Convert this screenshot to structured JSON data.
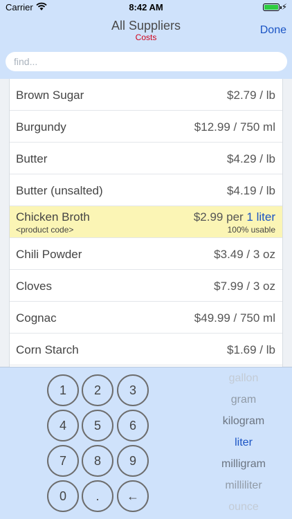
{
  "status_bar": {
    "carrier": "Carrier",
    "time": "8:42 AM"
  },
  "nav": {
    "title": "All Suppliers",
    "subtitle": "Costs",
    "done_label": "Done"
  },
  "search": {
    "placeholder": "find...",
    "value": ""
  },
  "items": [
    {
      "name": "Brown Sugar",
      "price": "$2.79 / lb"
    },
    {
      "name": "Burgundy",
      "price": "$12.99 / 750 ml"
    },
    {
      "name": "Butter",
      "price": "$4.29 / lb"
    },
    {
      "name": "Butter (unsalted)",
      "price": "$4.19 / lb"
    },
    {
      "name": "Chicken Broth",
      "price": "$2.99 per",
      "unit": "1 liter",
      "product_code": "<product code>",
      "usable": "100% usable",
      "selected": true
    },
    {
      "name": "Chili Powder",
      "price": "$3.49 / 3 oz"
    },
    {
      "name": "Cloves",
      "price": "$7.99 / 3 oz"
    },
    {
      "name": "Cognac",
      "price": "$49.99 / 750 ml"
    },
    {
      "name": "Corn Starch",
      "price": "$1.69 / lb"
    }
  ],
  "keypad": {
    "keys": [
      "1",
      "2",
      "3",
      "4",
      "5",
      "6",
      "7",
      "8",
      "9",
      "0",
      ".",
      "←"
    ]
  },
  "unit_picker": {
    "options": [
      "gallon",
      "gram",
      "kilogram",
      "liter",
      "milligram",
      "milliliter",
      "ounce"
    ],
    "selected": "liter"
  },
  "colors": {
    "accent": "#1a54c4",
    "subtitle": "#d0021b",
    "selected_row": "#fbf5b5",
    "header_bg": "#cfe2fb"
  }
}
